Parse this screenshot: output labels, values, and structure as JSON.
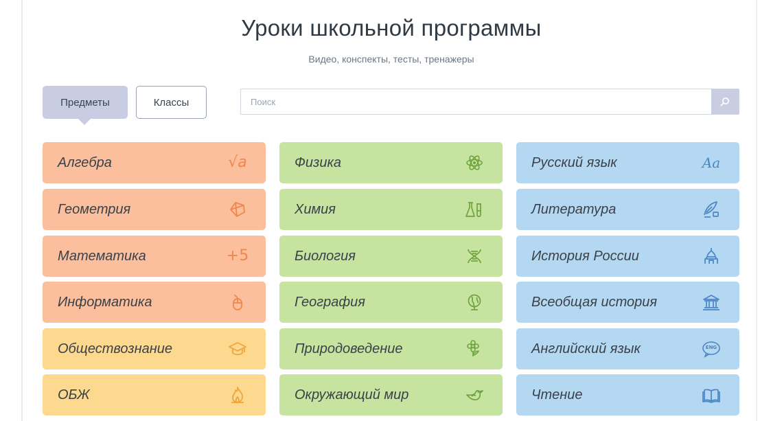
{
  "header": {
    "title": "Уроки школьной программы",
    "subtitle": "Видео, конспекты, тесты, тренажеры"
  },
  "tabs": {
    "subjects_label": "Предметы",
    "classes_label": "Классы",
    "active": "subjects"
  },
  "search": {
    "placeholder": "Поиск",
    "value": "",
    "icon": "search-icon"
  },
  "colors": {
    "orange": "#fbbf9d",
    "yellow": "#fcd98f",
    "green": "#c7e3a0",
    "blue": "#b5d8f2",
    "tab_active": "#c8cde3"
  },
  "subjects": {
    "col1": [
      {
        "label": "Алгебра",
        "icon": "sqrt-icon",
        "icon_text": "√a",
        "color": "orange"
      },
      {
        "label": "Геометрия",
        "icon": "polyhedron-icon",
        "color": "orange"
      },
      {
        "label": "Математика",
        "icon": "plus-five-icon",
        "icon_text": "+5",
        "color": "orange"
      },
      {
        "label": "Информатика",
        "icon": "mouse-icon",
        "color": "orange"
      },
      {
        "label": "Обществознание",
        "icon": "graduation-cap-icon",
        "color": "yellow"
      },
      {
        "label": "ОБЖ",
        "icon": "fire-icon",
        "color": "yellow"
      }
    ],
    "col2": [
      {
        "label": "Физика",
        "icon": "atom-icon",
        "color": "green"
      },
      {
        "label": "Химия",
        "icon": "flasks-icon",
        "color": "green"
      },
      {
        "label": "Биология",
        "icon": "dna-icon",
        "color": "green"
      },
      {
        "label": "География",
        "icon": "globe-icon",
        "color": "green"
      },
      {
        "label": "Природоведение",
        "icon": "flower-icon",
        "color": "green"
      },
      {
        "label": "Окружающий мир",
        "icon": "bird-icon",
        "color": "green"
      }
    ],
    "col3": [
      {
        "label": "Русский язык",
        "icon": "letters-icon",
        "icon_text": "Aa",
        "color": "blue"
      },
      {
        "label": "Литература",
        "icon": "quill-icon",
        "color": "blue"
      },
      {
        "label": "История России",
        "icon": "cathedral-icon",
        "color": "blue"
      },
      {
        "label": "Всеобщая история",
        "icon": "museum-icon",
        "color": "blue"
      },
      {
        "label": "Английский язык",
        "icon": "eng-bubble-icon",
        "icon_text": "ENG",
        "color": "blue"
      },
      {
        "label": "Чтение",
        "icon": "book-icon",
        "color": "blue"
      }
    ]
  }
}
